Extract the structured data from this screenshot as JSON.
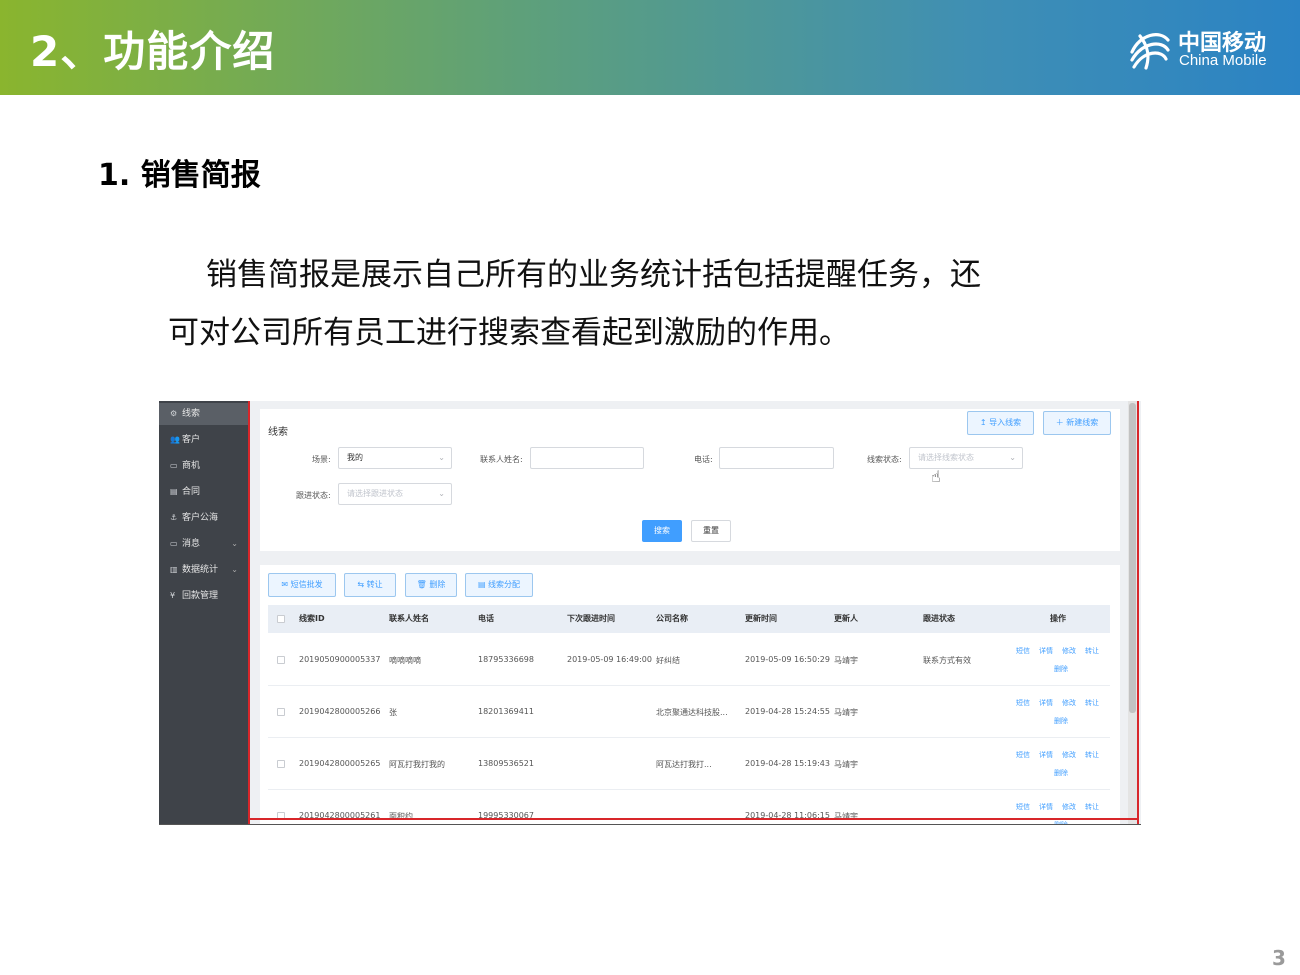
{
  "slide": {
    "title": "2、功能介绍",
    "logo_cn": "中国移动",
    "logo_en": "China Mobile",
    "section": "1. 销售简报",
    "paragraph_line1": "销售简报是展示自己所有的业务统计括包括提醒任务，还",
    "paragraph_line2": "可对公司所有员工进行搜索查看起到激励的作用。",
    "page_number": "3"
  },
  "app": {
    "sidebar": [
      {
        "label": "线索",
        "icon": "gear-icon",
        "glyph": "⚙",
        "active": true
      },
      {
        "label": "客户",
        "icon": "users-icon",
        "glyph": "👥"
      },
      {
        "label": "商机",
        "icon": "card-icon",
        "glyph": "▭"
      },
      {
        "label": "合同",
        "icon": "document-icon",
        "glyph": "▤"
      },
      {
        "label": "客户公海",
        "icon": "anchor-icon",
        "glyph": "⚓"
      },
      {
        "label": "消息",
        "icon": "message-icon",
        "glyph": "▭",
        "caret": "⌄"
      },
      {
        "label": "数据统计",
        "icon": "bar-chart-icon",
        "glyph": "▥",
        "caret": "⌄"
      },
      {
        "label": "回款管理",
        "icon": "yen-icon",
        "glyph": "¥"
      }
    ],
    "search_panel": {
      "title": "线索",
      "import_btn": "↥ 导入线索",
      "new_btn": "＋ 新建线索",
      "filter_label": "场景:",
      "filter_value": "我的",
      "contact_label": "联系人姓名:",
      "phone_label": "电话:",
      "status_label": "线索状态:",
      "status_placeholder": "请选择线索状态",
      "follow_label": "跟进状态:",
      "follow_placeholder": "请选择跟进状态",
      "search_btn": "搜索",
      "reset_btn": "重置"
    },
    "toolbar": {
      "sms_btn": "✉ 短信批发",
      "transfer_btn": "⇆ 转让",
      "delete_btn": "🗑 删除",
      "assign_btn": "▤ 线索分配"
    },
    "table": {
      "headers": [
        "线索ID",
        "联系人姓名",
        "电话",
        "下次跟进时间",
        "公司名称",
        "更新时间",
        "更新人",
        "跟进状态",
        "操作"
      ],
      "rows": [
        {
          "id": "2019050900005337",
          "name": "嘀嘀嘀嘀",
          "phone": "18795336698",
          "next": "2019-05-09 16:49:00",
          "company": "好纠结",
          "updated": "2019-05-09 16:50:29",
          "updater": "马靖宇",
          "status": "联系方式有效"
        },
        {
          "id": "2019042800005266",
          "name": "张",
          "phone": "18201369411",
          "next": "",
          "company": "北京聚通达科技股...",
          "updated": "2019-04-28 15:24:55",
          "updater": "马靖宇",
          "status": ""
        },
        {
          "id": "2019042800005265",
          "name": "阿瓦打我打我的",
          "phone": "13809536521",
          "next": "",
          "company": "阿瓦达打我打...",
          "updated": "2019-04-28 15:19:43",
          "updater": "马靖宇",
          "status": ""
        },
        {
          "id": "2019042800005261",
          "name": "面积约",
          "phone": "19995330067",
          "next": "",
          "company": "",
          "updated": "2019-04-28 11:06:15",
          "updater": "马靖宇",
          "status": ""
        }
      ],
      "actions": {
        "sms": "短信",
        "detail": "详情",
        "edit": "修改",
        "transfer": "转让",
        "delete": "删除"
      }
    }
  },
  "colors": {
    "primary": "#409eff",
    "header_green": "#8ab52e",
    "header_blue": "#2b83c4",
    "sidebar": "#3f4349"
  }
}
